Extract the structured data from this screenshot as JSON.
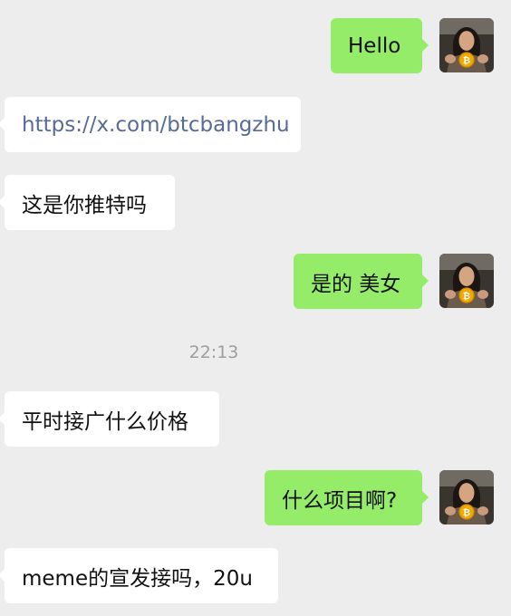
{
  "colors": {
    "background": "#ededed",
    "incoming_bubble": "#ffffff",
    "outgoing_bubble": "#95ec69",
    "link_text": "#576b95",
    "timestamp_text": "#9e9e9e"
  },
  "avatar_icon": "bitcoin-coin-icon",
  "messages": [
    {
      "direction": "outgoing",
      "text": "Hello"
    },
    {
      "direction": "incoming",
      "text": "https://x.com/btcbangzhu",
      "is_link": true
    },
    {
      "direction": "incoming",
      "text": "这是你推特吗"
    },
    {
      "direction": "outgoing",
      "text": "是的 美女"
    },
    {
      "direction": "incoming",
      "text": "平时接广什么价格"
    },
    {
      "direction": "outgoing",
      "text": "什么项目啊?"
    },
    {
      "direction": "incoming",
      "text": "meme的宣发接吗，20u"
    }
  ],
  "timestamp": "22:13"
}
